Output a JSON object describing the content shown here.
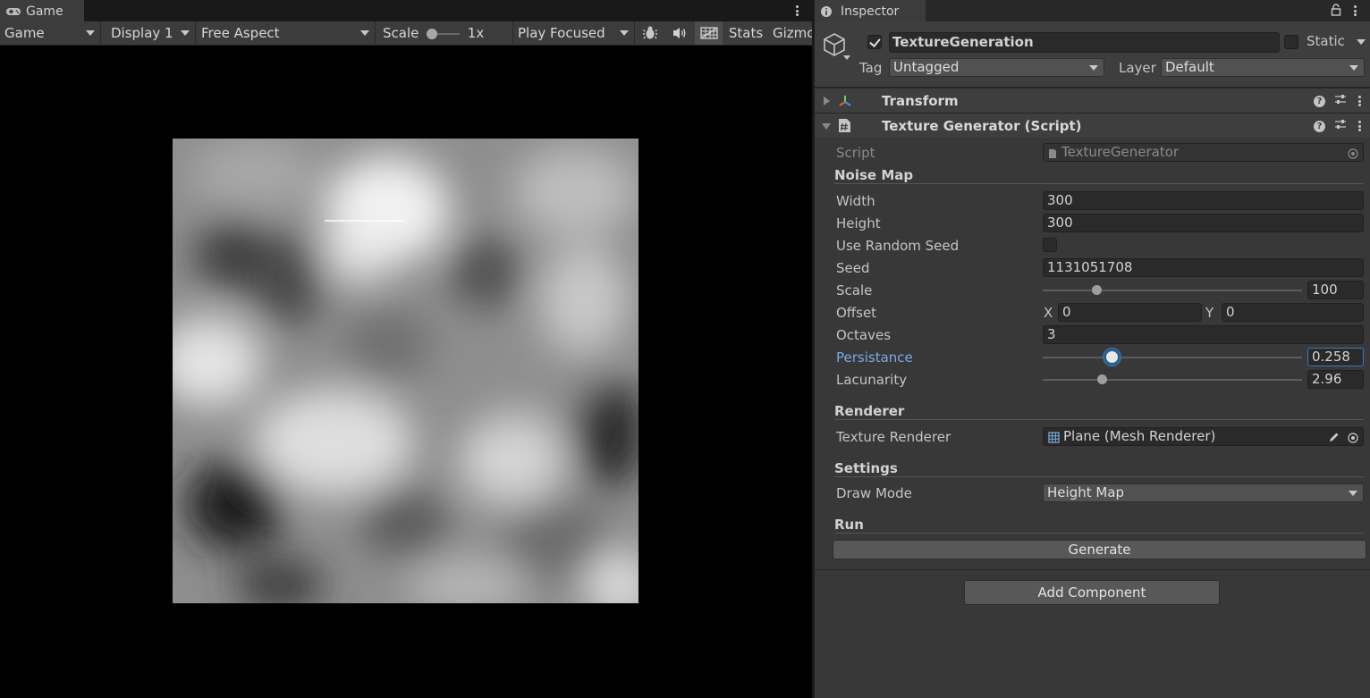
{
  "game": {
    "tab_label": "Game",
    "tab_icon": "gamepad-icon",
    "toolbar": {
      "view_mode": "Game",
      "display": "Display 1",
      "aspect": "Free Aspect",
      "scale_label": "Scale",
      "scale_value": "1x",
      "scale_level": 0,
      "play_mode": "Play Focused",
      "stats_label": "Stats",
      "gizmos_label": "Gizmos"
    }
  },
  "inspector": {
    "tab_label": "Inspector",
    "tab_icon": "info-icon",
    "object": {
      "active": true,
      "name": "TextureGeneration",
      "static_label": "Static",
      "static": false,
      "tag_label": "Tag",
      "tag_value": "Untagged",
      "layer_label": "Layer",
      "layer_value": "Default"
    },
    "transform": {
      "title": "Transform",
      "expanded": false
    },
    "texture_generator": {
      "title": "Texture Generator (Script)",
      "expanded": true,
      "script_label": "Script",
      "script_value": "TextureGenerator",
      "sections": {
        "noise_map": "Noise Map",
        "renderer": "Renderer",
        "settings": "Settings",
        "run": "Run"
      },
      "fields": {
        "width": {
          "label": "Width",
          "value": "300"
        },
        "height": {
          "label": "Height",
          "value": "300"
        },
        "use_random_seed": {
          "label": "Use Random Seed",
          "checked": false
        },
        "seed": {
          "label": "Seed",
          "value": "1131051708"
        },
        "scale": {
          "label": "Scale",
          "value": "100",
          "slider_fraction": 0.21
        },
        "offset": {
          "label": "Offset",
          "x_label": "X",
          "x_value": "0",
          "y_label": "Y",
          "y_value": "0"
        },
        "octaves": {
          "label": "Octaves",
          "value": "3"
        },
        "persistance": {
          "label": "Persistance",
          "value": "0.258",
          "slider_fraction": 0.268
        },
        "lacunarity": {
          "label": "Lacunarity",
          "value": "2.96",
          "slider_fraction": 0.23
        },
        "texture_renderer": {
          "label": "Texture Renderer",
          "value": "Plane (Mesh Renderer)"
        },
        "draw_mode": {
          "label": "Draw Mode",
          "value": "Height Map"
        }
      },
      "generate_button": "Generate"
    },
    "add_component_button": "Add Component"
  },
  "colors": {
    "accent_blue": "#3a79bb",
    "focused_label": "#7ba9e3",
    "panel_bg": "#383838",
    "toolbar_bg": "#3c3c3c",
    "game_bg": "#000000"
  }
}
